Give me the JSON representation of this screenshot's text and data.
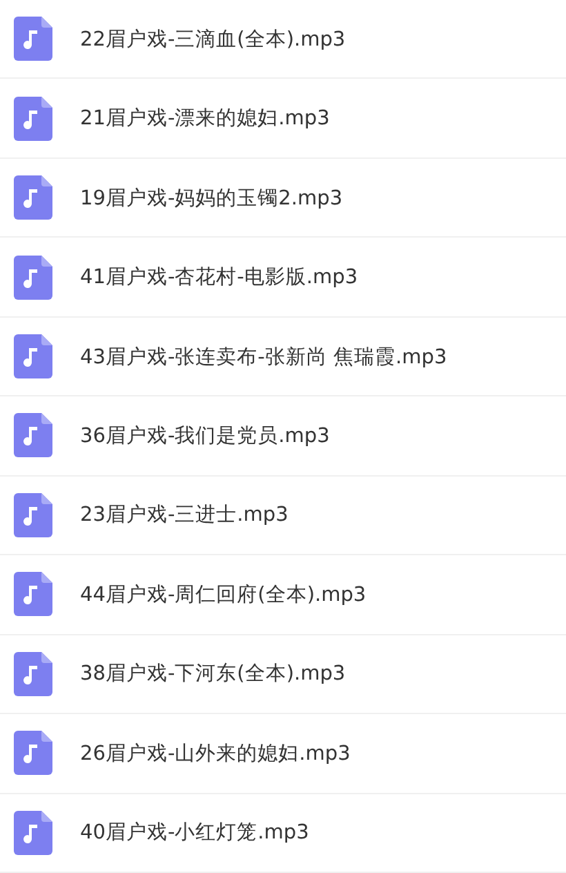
{
  "files": [
    {
      "name": "22眉户戏-三滴血(全本).mp3"
    },
    {
      "name": "21眉户戏-漂来的媳妇.mp3"
    },
    {
      "name": "19眉户戏-妈妈的玉镯2.mp3"
    },
    {
      "name": "41眉户戏-杏花村-电影版.mp3"
    },
    {
      "name": "43眉户戏-张连卖布-张新尚 焦瑞霞.mp3"
    },
    {
      "name": "36眉户戏-我们是党员.mp3"
    },
    {
      "name": "23眉户戏-三进士.mp3"
    },
    {
      "name": "44眉户戏-周仁回府(全本).mp3"
    },
    {
      "name": "38眉户戏-下河东(全本).mp3"
    },
    {
      "name": "26眉户戏-山外来的媳妇.mp3"
    },
    {
      "name": "40眉户戏-小红灯笼.mp3"
    }
  ]
}
